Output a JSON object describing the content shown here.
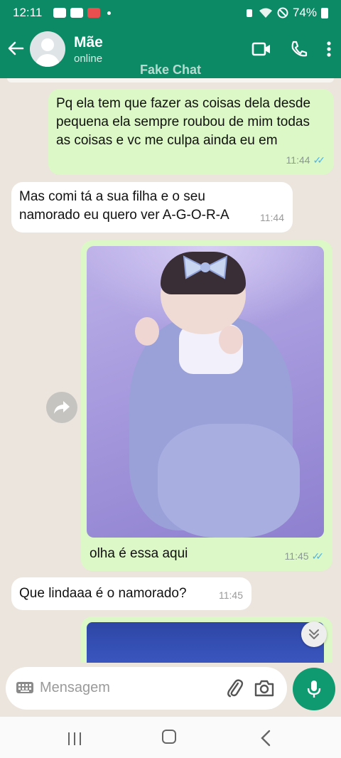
{
  "status_bar": {
    "time": "12:11",
    "battery": "74%"
  },
  "header": {
    "contact_name": "Mãe",
    "contact_status": "online",
    "watermark": "Fake Chat"
  },
  "messages": [
    {
      "direction": "out",
      "text": "Pq ela tem que fazer as coisas dela desde pequena ela sempre roubou de mim todas as coisas e vc me culpa ainda eu em",
      "time": "11:44",
      "read": true
    },
    {
      "direction": "in",
      "text": "Mas comi tá a sua filha e o seu namorado eu quero ver A-G-O-R-A",
      "time": "11:44"
    },
    {
      "direction": "out",
      "type": "image",
      "caption": "olha é essa aqui",
      "time": "11:45",
      "read": true
    },
    {
      "direction": "in",
      "text": "Que lindaaa é o namorado?",
      "time": "11:45"
    },
    {
      "direction": "out",
      "type": "image",
      "partial": true
    }
  ],
  "composer": {
    "placeholder": "Mensagem"
  },
  "icons": {
    "back": "arrow-left-icon",
    "video": "video-call-icon",
    "call": "phone-icon",
    "menu": "more-vert-icon",
    "forward": "forward-icon",
    "scroll": "double-chevron-down-icon",
    "keyboard": "keyboard-icon",
    "attach": "paperclip-icon",
    "camera": "camera-icon",
    "mic": "microphone-icon"
  },
  "colors": {
    "header": "#0b8a65",
    "outgoing": "#dcf8c6",
    "incoming": "#ffffff",
    "read_ticks": "#4fb6ec",
    "mic_button": "#0f9a70"
  }
}
